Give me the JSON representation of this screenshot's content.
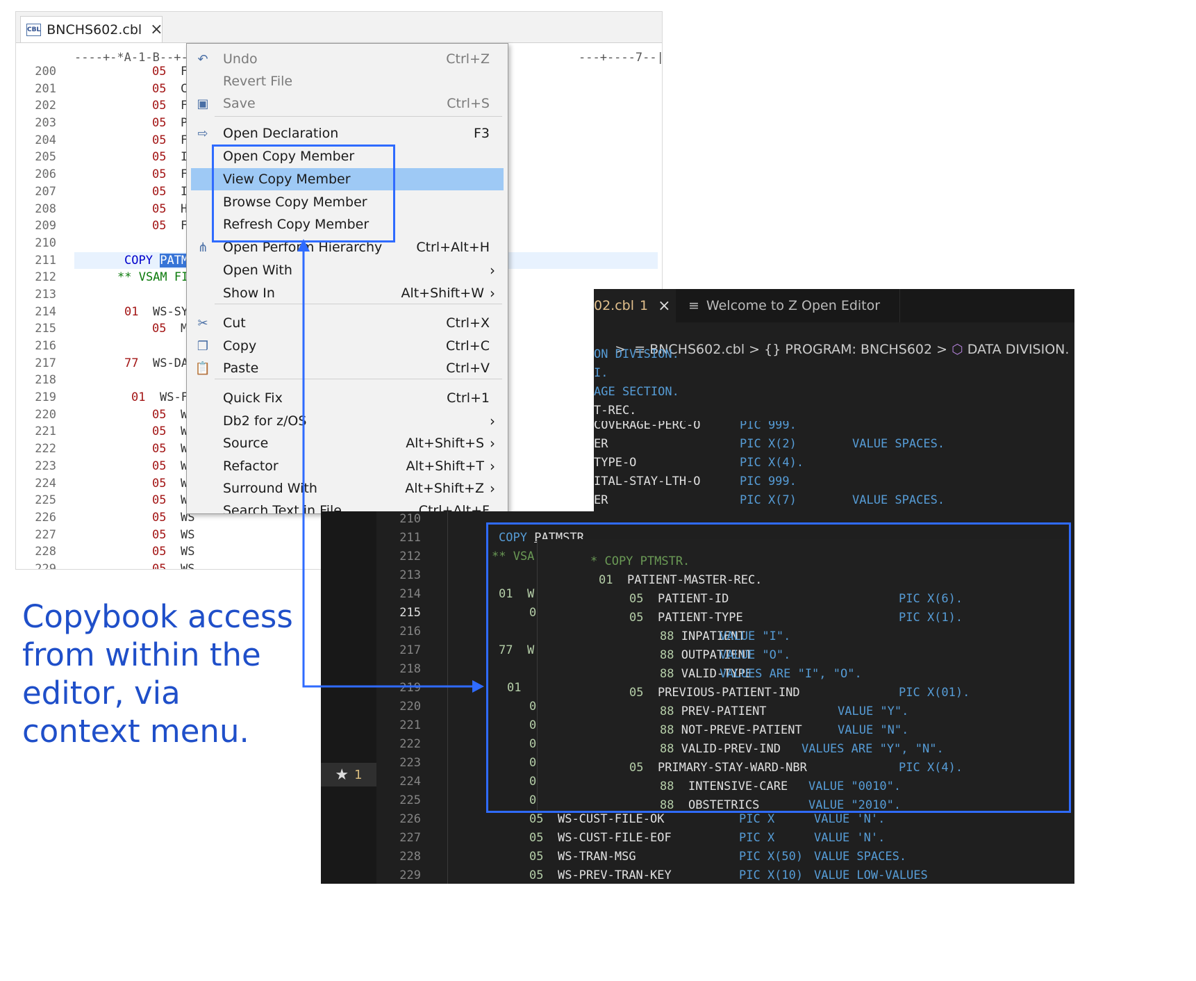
{
  "eclipse": {
    "tab_title": "BNCHS602.cbl",
    "file_icon": "CBL",
    "ruler_left": "----+-*A-1-B--+--",
    "ruler_right": "---+----7--|",
    "line_numbers": [
      "200",
      "201",
      "202",
      "203",
      "204",
      "205",
      "206",
      "207",
      "208",
      "209",
      "210",
      "211",
      "212",
      "213",
      "214",
      "215",
      "216",
      "217",
      "218",
      "219",
      "220",
      "221",
      "222",
      "223",
      "224",
      "225",
      "226",
      "227",
      "228",
      "229"
    ],
    "lines": [
      {
        "lvl": "05",
        "txt": "FI"
      },
      {
        "lvl": "05",
        "txt": "CU"
      },
      {
        "lvl": "05",
        "txt": "FI"
      },
      {
        "lvl": "05",
        "txt": "PA"
      },
      {
        "lvl": "05",
        "txt": "FI"
      },
      {
        "lvl": "05",
        "txt": "IN"
      },
      {
        "lvl": "05",
        "txt": "FI"
      },
      {
        "lvl": "05",
        "txt": "IN"
      },
      {
        "lvl": "05",
        "txt": "HC"
      },
      {
        "lvl": "05",
        "txt": "FI"
      },
      {
        "lvl": "",
        "txt": ""
      },
      {
        "kw": "COPY",
        "sel": "PATMS"
      },
      {
        "cm": "** VSAM FIL"
      },
      {
        "lvl": "",
        "txt": ""
      },
      {
        "lvl": "01",
        "txt": "WS-SYS"
      },
      {
        "lvl": "05",
        "txt": "MS"
      },
      {
        "lvl": "",
        "txt": ""
      },
      {
        "lvl": "77",
        "txt": "WS-DAT"
      },
      {
        "lvl": "",
        "txt": ""
      },
      {
        "lvl": "01",
        "txt": "WS-FI"
      },
      {
        "lvl": "05",
        "txt": "WS"
      },
      {
        "lvl": "05",
        "txt": "WS"
      },
      {
        "lvl": "05",
        "txt": "WS"
      },
      {
        "lvl": "05",
        "txt": "WS"
      },
      {
        "lvl": "05",
        "txt": "WS"
      },
      {
        "lvl": "05",
        "txt": "WS"
      },
      {
        "lvl": "05",
        "txt": "WS"
      },
      {
        "lvl": "05",
        "txt": "WS"
      },
      {
        "lvl": "05",
        "txt": "WS"
      },
      {
        "lvl": "05",
        "txt": "WS"
      }
    ]
  },
  "context_menu": {
    "items": [
      {
        "label": "Undo",
        "shortcut": "Ctrl+Z",
        "icon": "undo-icon",
        "disabled": true
      },
      {
        "label": "Revert File",
        "shortcut": "",
        "icon": "",
        "disabled": true
      },
      {
        "label": "Save",
        "shortcut": "Ctrl+S",
        "icon": "save-icon",
        "disabled": true
      },
      {
        "label": "Open Declaration",
        "shortcut": "F3",
        "icon": "open-declaration-icon"
      },
      {
        "label": "Open Copy Member",
        "shortcut": ""
      },
      {
        "label": "View Copy Member",
        "shortcut": "",
        "active": true
      },
      {
        "label": "Browse Copy Member",
        "shortcut": ""
      },
      {
        "label": "Refresh Copy Member",
        "shortcut": ""
      },
      {
        "label": "Open Perform Hierarchy",
        "shortcut": "Ctrl+Alt+H",
        "icon": "hierarchy-icon"
      },
      {
        "label": "Open With",
        "shortcut": "",
        "submenu": true
      },
      {
        "label": "Show In",
        "shortcut": "Alt+Shift+W",
        "submenu": true
      },
      {
        "label": "Cut",
        "shortcut": "Ctrl+X",
        "icon": "scissors-icon"
      },
      {
        "label": "Copy",
        "shortcut": "Ctrl+C",
        "icon": "copy-icon"
      },
      {
        "label": "Paste",
        "shortcut": "Ctrl+V",
        "icon": "paste-icon"
      },
      {
        "label": "Quick Fix",
        "shortcut": "Ctrl+1"
      },
      {
        "label": "Db2 for z/OS",
        "shortcut": "",
        "submenu": true
      },
      {
        "label": "Source",
        "shortcut": "Alt+Shift+S",
        "submenu": true
      },
      {
        "label": "Refactor",
        "shortcut": "Alt+Shift+T",
        "submenu": true
      },
      {
        "label": "Surround With",
        "shortcut": "Alt+Shift+Z",
        "submenu": true
      },
      {
        "label": "Search Text in File",
        "shortcut": "Ctrl+Alt+F"
      }
    ]
  },
  "vscode": {
    "tab_active": "02.cbl",
    "tab_active_count": "1",
    "tab_welcome": "Welcome to Z Open Editor",
    "breadcrumb": {
      "file": "BNCHS602.cbl",
      "program": "PROGRAM: BNCHS602",
      "division": "DATA DIVISION."
    },
    "top_lines": [
      {
        "a": "ON DIVISION."
      },
      {
        "a": "I."
      },
      {
        "a": "AGE SECTION."
      },
      {
        "a": "T-REC."
      }
    ],
    "mid_lines": [
      {
        "a": "COVERAGE-PERC-O",
        "pic": "PIC 999.",
        "val": ""
      },
      {
        "a": "ER",
        "pic": "PIC X(2)",
        "val": "VALUE SPACES."
      },
      {
        "a": "TYPE-O",
        "pic": "PIC X(4).",
        "val": ""
      },
      {
        "a": "ITAL-STAY-LTH-O",
        "pic": "PIC 999.",
        "val": ""
      },
      {
        "a": "ER",
        "pic": "PIC X(7)",
        "val": "VALUE SPACES."
      }
    ],
    "line_numbers": [
      "210",
      "211",
      "212",
      "213",
      "214",
      "215",
      "216",
      "217",
      "218",
      "219",
      "220",
      "221",
      "222",
      "223",
      "224",
      "225",
      "226",
      "227",
      "228",
      "229"
    ],
    "current_line": "215",
    "badge_count": "1",
    "main_copy": "COPY",
    "main_copy_name": "PATMSTR.",
    "main_vsam": "** VSA",
    "left_code": {
      "l214": "01  W",
      "l215": "0",
      "l217": "77  W",
      "l219": "01",
      "stub": "0"
    },
    "bottom_lines": [
      {
        "lvl": "05",
        "name": "WS-CUST-FILE-OK",
        "pic": "PIC X",
        "val": "VALUE 'N'."
      },
      {
        "lvl": "05",
        "name": "WS-CUST-FILE-EOF",
        "pic": "PIC X",
        "val": "VALUE 'N'."
      },
      {
        "lvl": "05",
        "name": "WS-TRAN-MSG",
        "pic": "PIC X(50)",
        "val": "VALUE SPACES."
      },
      {
        "lvl": "05",
        "name": "WS-PREV-TRAN-KEY",
        "pic": "PIC X(10)",
        "val": "VALUE LOW-VALUES"
      }
    ],
    "peek": {
      "lines": [
        {
          "t": "* COPY PTMSTR.",
          "cls": "cm"
        },
        {
          "t": "01  PATIENT-MASTER-REC."
        },
        {
          "t": "05  PATIENT-ID",
          "pic": "PIC X(6)."
        },
        {
          "t": "05  PATIENT-TYPE",
          "pic": "PIC X(1)."
        },
        {
          "t": "88 INPATIENT",
          "val": "VALUE \"I\"."
        },
        {
          "t": "88 OUTPATIENT",
          "val": "VALUE \"O\"."
        },
        {
          "t": "88 VALID-TYPE",
          "val": "VALUES ARE \"I\", \"O\"."
        },
        {
          "t": "05  PREVIOUS-PATIENT-IND",
          "pic": "PIC X(01)."
        },
        {
          "t": "88 PREV-PATIENT",
          "val": "VALUE \"Y\"."
        },
        {
          "t": "88 NOT-PREVE-PATIENT",
          "val": "VALUE \"N\"."
        },
        {
          "t": "88 VALID-PREV-IND",
          "val": "VALUES ARE \"Y\", \"N\"."
        },
        {
          "t": "05  PRIMARY-STAY-WARD-NBR",
          "pic": "PIC X(4)."
        },
        {
          "t": "88  INTENSIVE-CARE",
          "val": "VALUE \"0010\"."
        },
        {
          "t": "88  OBSTETRICS",
          "val": "VALUE \"2010\"."
        }
      ]
    }
  },
  "caption": "Copybook access from within the editor, via context menu.",
  "colors": {
    "accent_blue": "#2f6bff",
    "caption_blue": "#1f4fc9",
    "menu_highlight": "#9ec9f5"
  }
}
